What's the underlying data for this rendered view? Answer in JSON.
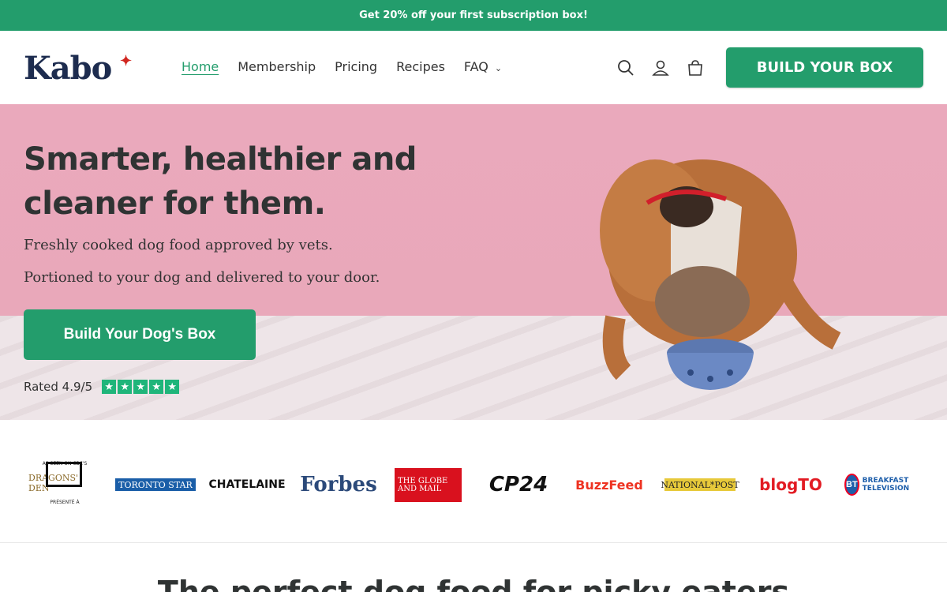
{
  "announcement": "Get 20% off your first subscription box!",
  "header": {
    "logo": "Kabo",
    "nav": [
      {
        "label": "Home",
        "active": true
      },
      {
        "label": "Membership"
      },
      {
        "label": "Pricing"
      },
      {
        "label": "Recipes"
      },
      {
        "label": "FAQ",
        "has_dropdown": true
      }
    ],
    "icons": [
      "search-icon",
      "account-icon",
      "cart-icon"
    ],
    "cta": "BUILD YOUR BOX"
  },
  "hero": {
    "title": "Smarter, healthier and cleaner for them.",
    "subtitle_line1": "Freshly cooked dog food approved by vets.",
    "subtitle_line2": "Portioned to your dog and delivered to your door.",
    "cta": "Build Your Dog's Box",
    "rating_text": "Rated 4.9/5",
    "stars": 5,
    "image": "bulldog-eating-from-bowl"
  },
  "press": {
    "dragons_top": "AS SEEN ON CBC'S",
    "dragons_name": "DRAGONS' DEN",
    "dragons_bottom": "PRÉSENTÉ À",
    "toronto_star": "TORONTO STAR",
    "chatelaine": "CHATELAINE",
    "forbes": "Forbes",
    "globe_mail": "THE GLOBE AND MAIL",
    "cp24": "CP24",
    "buzzfeed": "BuzzFeed",
    "national_post": "NATIONAL*POST",
    "blogto": "blogTO",
    "bt_badge": "BT",
    "bt_text": "BREAKFAST TELEVISION"
  },
  "next_section_heading": "The perfect dog food for picky eaters",
  "colors": {
    "brand_green": "#239d6c",
    "hero_pink": "#e9a8ba",
    "logo_navy": "#1d2c4f"
  }
}
